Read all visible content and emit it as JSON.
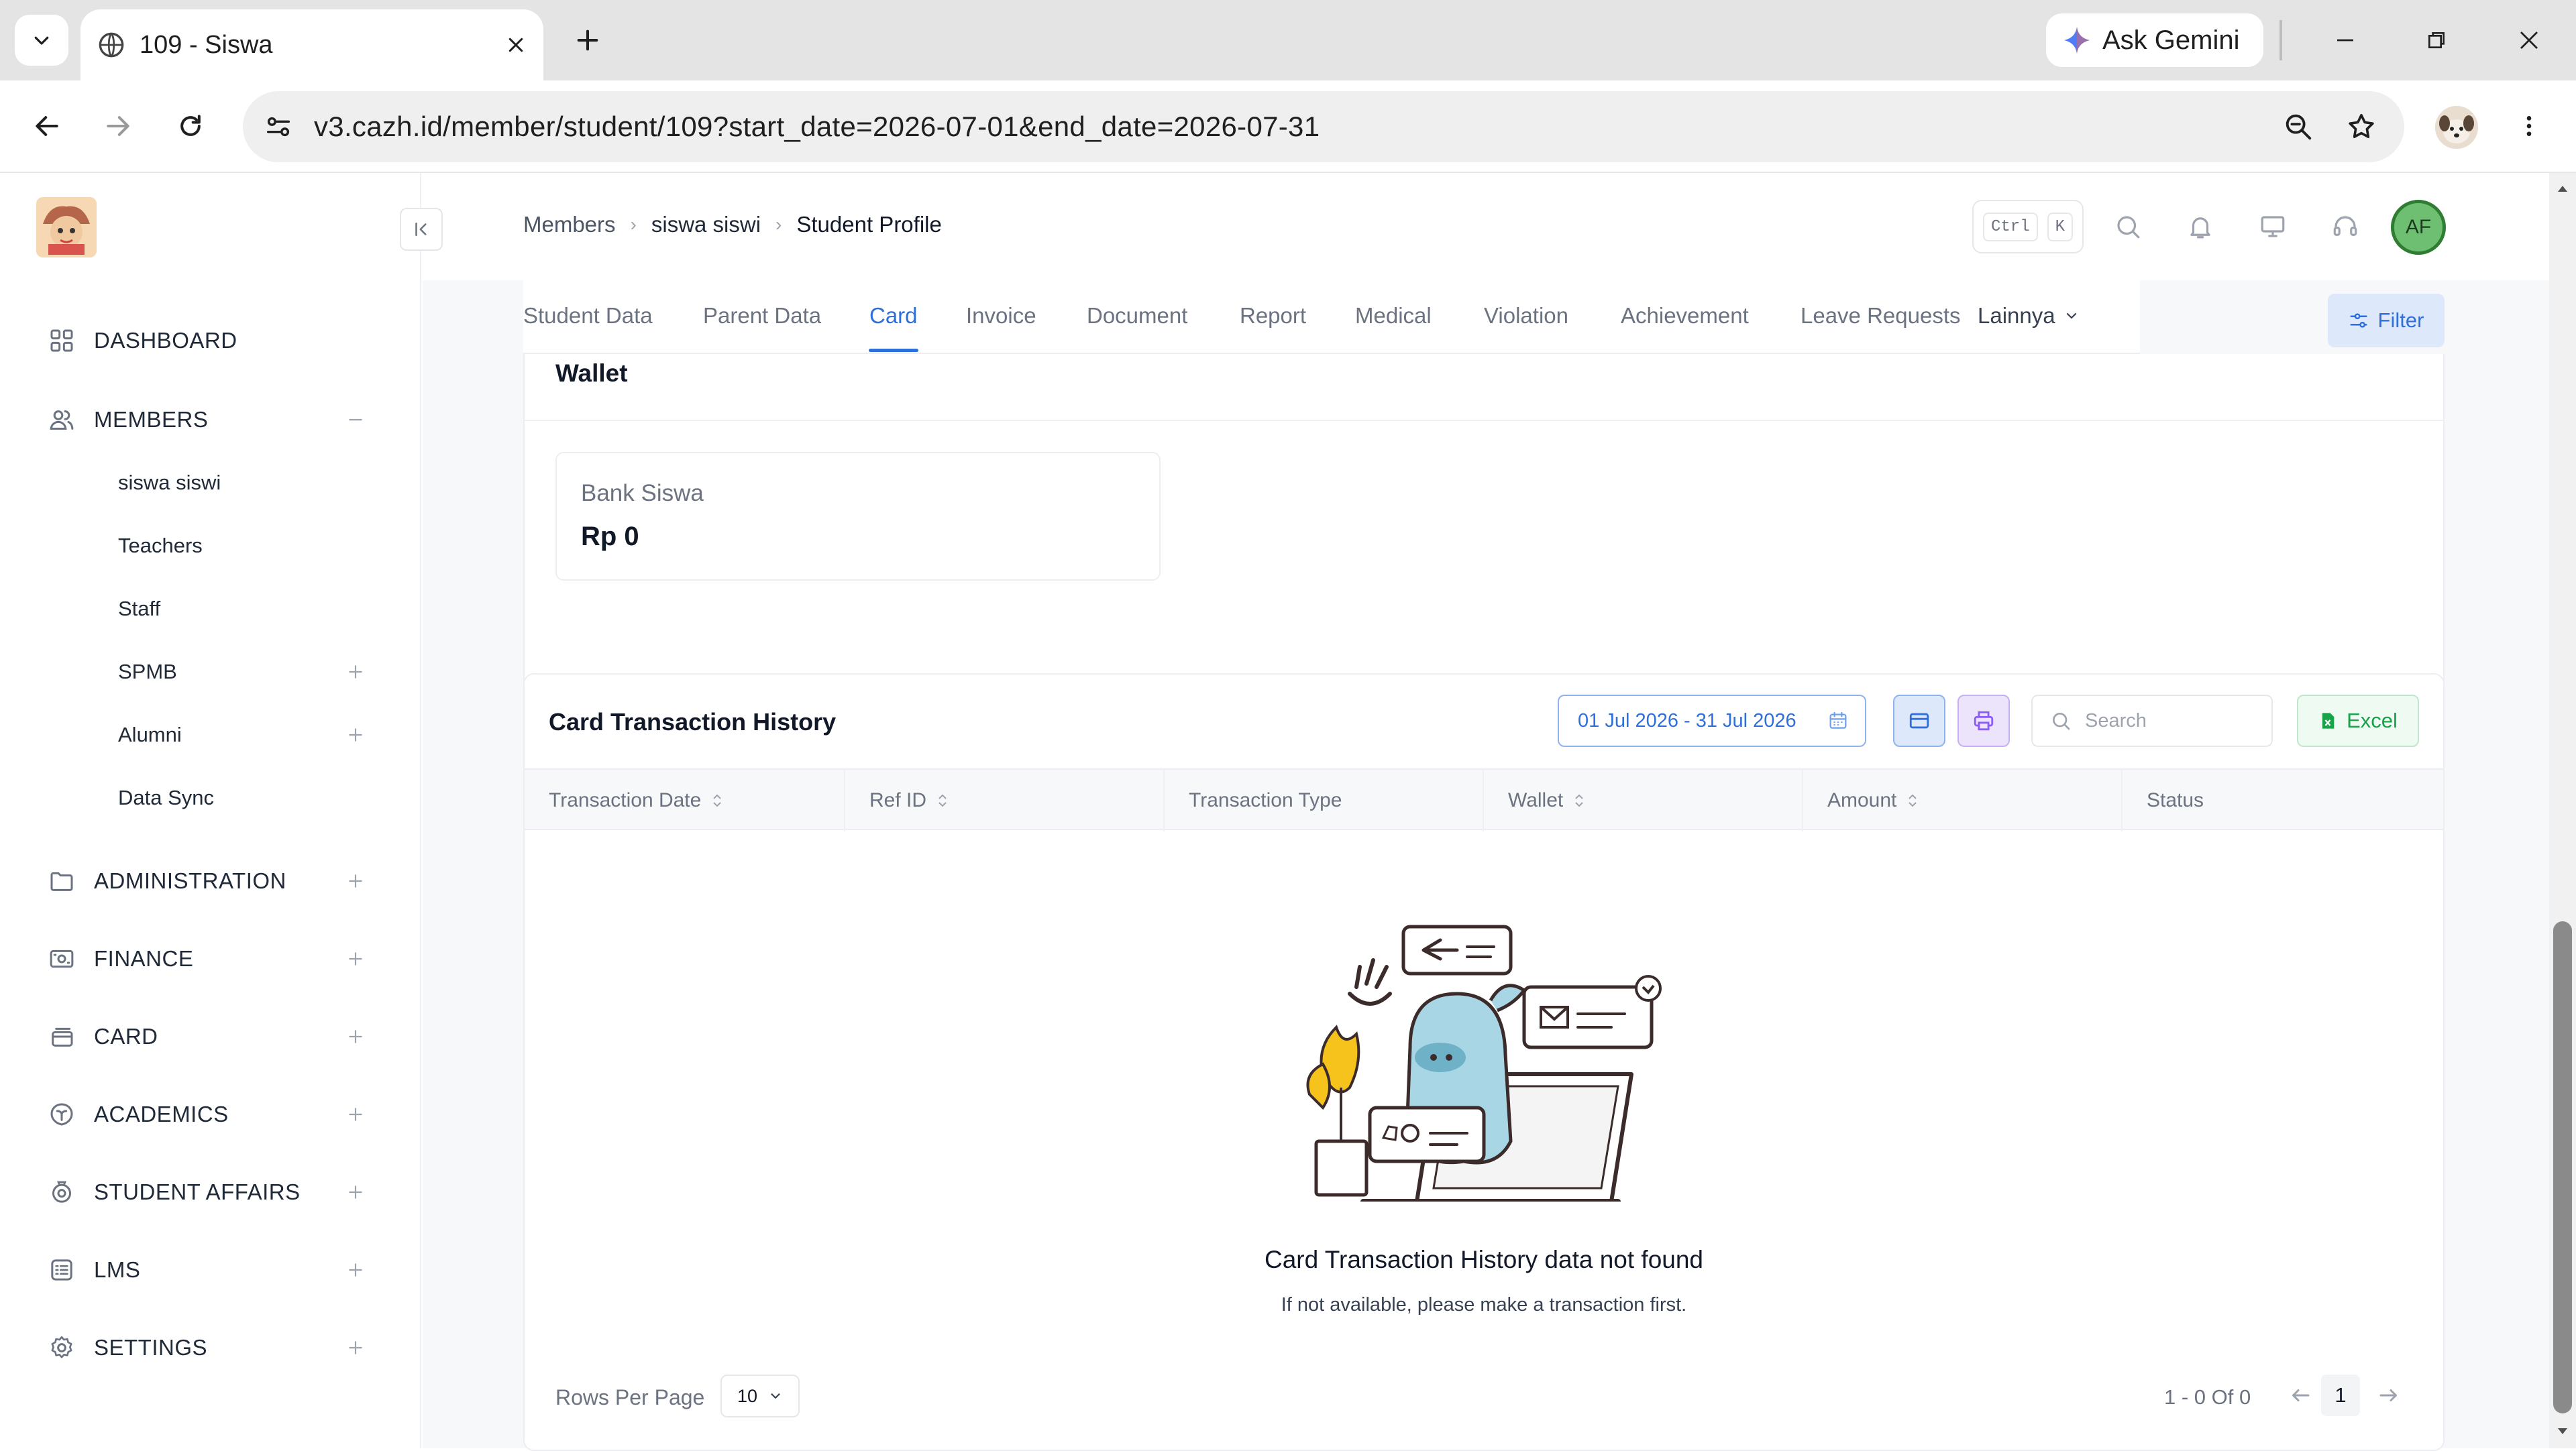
{
  "browser": {
    "tab_title": "109 - Siswa",
    "url": "v3.cazh.id/member/student/109?start_date=2026-07-01&end_date=2026-07-31",
    "gemini_label": "Ask Gemini"
  },
  "sidebar": {
    "items": [
      {
        "label": "DASHBOARD",
        "icon": "dashboard-icon"
      },
      {
        "label": "MEMBERS",
        "icon": "members-icon",
        "expanded": true
      },
      {
        "label": "ADMINISTRATION",
        "icon": "folder-icon"
      },
      {
        "label": "FINANCE",
        "icon": "finance-icon"
      },
      {
        "label": "CARD",
        "icon": "card-icon"
      },
      {
        "label": "ACADEMICS",
        "icon": "academics-icon"
      },
      {
        "label": "STUDENT AFFAIRS",
        "icon": "student-affairs-icon"
      },
      {
        "label": "LMS",
        "icon": "lms-icon"
      },
      {
        "label": "SETTINGS",
        "icon": "gear-icon"
      }
    ],
    "members_sub": [
      {
        "label": "siswa siswi"
      },
      {
        "label": "Teachers"
      },
      {
        "label": "Staff"
      },
      {
        "label": "SPMB"
      },
      {
        "label": "Alumni"
      },
      {
        "label": "Data Sync"
      }
    ]
  },
  "header": {
    "breadcrumb": [
      "Members",
      "siswa siswi",
      "Student Profile"
    ],
    "shortcut_keys": [
      "Ctrl",
      "K"
    ],
    "avatar_initials": "AF"
  },
  "profile_tabs": {
    "items": [
      "Student Data",
      "Parent Data",
      "Card",
      "Invoice",
      "Document",
      "Report",
      "Medical",
      "Violation",
      "Achievement",
      "Leave Requests"
    ],
    "active": "Card",
    "more_label": "Lainnya",
    "filter_label": "Filter"
  },
  "wallet": {
    "title": "Wallet",
    "bank_name": "Bank Siswa",
    "amount": "Rp 0"
  },
  "history": {
    "title": "Card Transaction History",
    "date_range": "01 Jul 2026 - 31 Jul 2026",
    "search_placeholder": "Search",
    "excel_label": "Excel",
    "columns": [
      "Transaction Date",
      "Ref ID",
      "Transaction Type",
      "Wallet",
      "Amount",
      "Status"
    ],
    "empty_title": "Card Transaction History data not found",
    "empty_subtitle": "If not available, please make a transaction first.",
    "rows_per_page_label": "Rows Per Page",
    "rows_per_page": "10",
    "page_info": "1 - 0 Of 0",
    "current_page": "1"
  },
  "colors": {
    "accent": "#2f6fdb",
    "excel": "#16a34a",
    "print": "#8b5cf6"
  }
}
